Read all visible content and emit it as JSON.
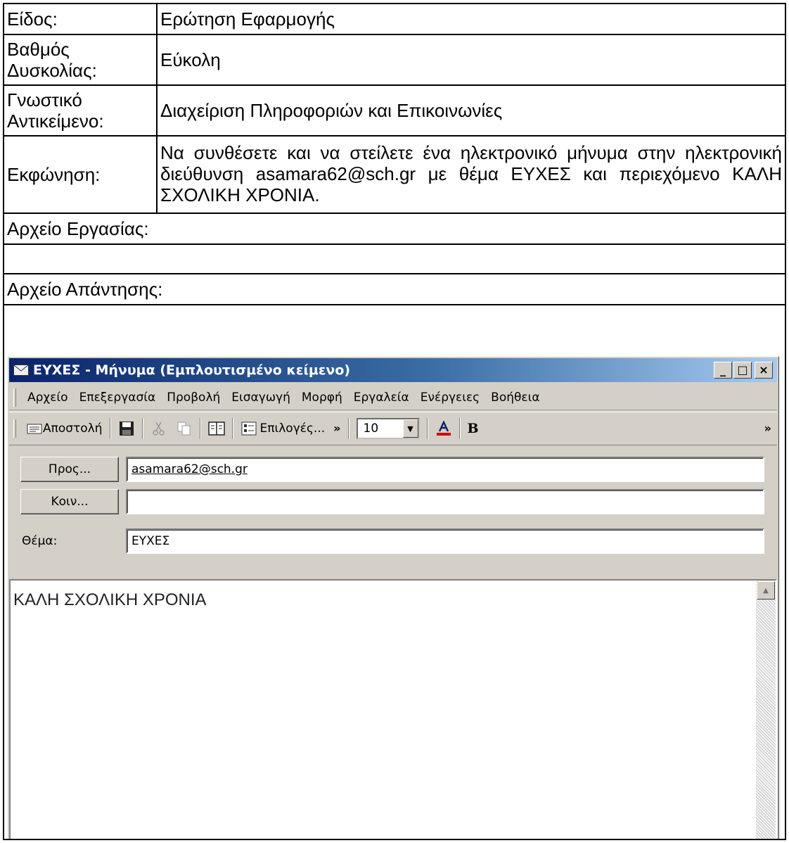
{
  "form": {
    "type_label": "Είδος:",
    "type_value": "Ερώτηση Εφαρμογής",
    "difficulty_label_1": "Βαθμός",
    "difficulty_label_2": "Δυσκολίας:",
    "difficulty_value": "Εύκολη",
    "subject_label_1": "Γνωστικό",
    "subject_label_2": "Αντικείμενο:",
    "subject_value": "Διαχείριση Πληροφοριών και Επικοινωνίες",
    "statement_label": "Εκφώνηση:",
    "statement_value": "Να συνθέσετε και να στείλετε ένα ηλεκτρονικό μήνυμα στην ηλεκτρονική διεύθυνση asamara62@sch.gr με θέμα ΕΥΧΕΣ και περιεχόμενο ΚΑΛΗ ΣΧΟΛΙΚΗ ΧΡΟΝΙΑ.",
    "work_file_label": "Αρχείο Εργασίας:",
    "work_file_value": "",
    "answer_file_label": "Αρχείο Απάντησης:"
  },
  "window": {
    "title": "ΕΥΧΕΣ - Μήνυμα (Εμπλουτισμένο κείμενο)",
    "title_icon": "envelope-icon",
    "controls": [
      "_",
      "□",
      "×"
    ],
    "menu": [
      "Αρχείο",
      "Επεξεργασία",
      "Προβολή",
      "Εισαγωγή",
      "Μορφή",
      "Εργαλεία",
      "Ενέργειες",
      "Βοήθεια"
    ],
    "toolbar": {
      "send_label": "Αποστολή",
      "options_label": "Επιλογές...",
      "font_size": "10",
      "bold_label": "B",
      "chevron": "»"
    },
    "to_button": "Προς...",
    "to_value": "asamara62@sch.gr",
    "cc_button": "Κοιν...",
    "cc_value": "",
    "subject_label": "Θέμα:",
    "subject_value": "ΕΥΧΕΣ",
    "body_text": "ΚΑΛΗ ΣΧΟΛΙΚΗ ΧΡΟΝΙΑ"
  },
  "colors": {
    "title_gradient_start": "#0a246a",
    "title_gradient_end": "#a6caf0",
    "window_face": "#d4d0c8",
    "font_color_red": "#d40000"
  }
}
